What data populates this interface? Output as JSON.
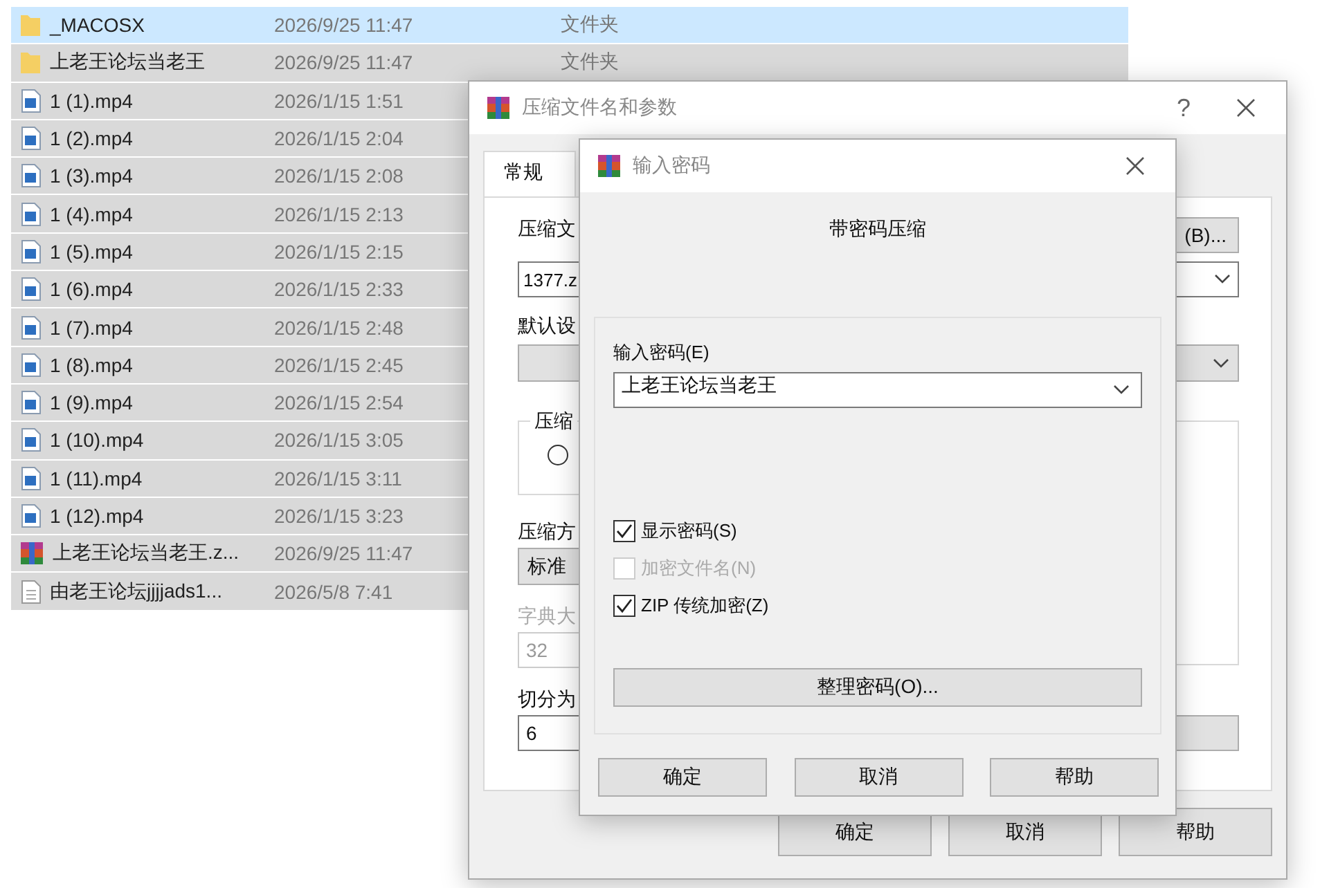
{
  "file_list": {
    "rows": [
      {
        "kind": "folder",
        "name": "_MACOSX",
        "date": "2026/9/25 11:47",
        "type": "文件夹",
        "selected": true,
        "focused": true
      },
      {
        "kind": "folder",
        "name": "上老王论坛当老王",
        "date": "2026/9/25 11:47",
        "type": "文件夹",
        "selected": true,
        "focused": false
      },
      {
        "kind": "video",
        "name": "1 (1).mp4",
        "date": "2026/1/15 1:51",
        "selected": true,
        "focused": false
      },
      {
        "kind": "video",
        "name": "1 (2).mp4",
        "date": "2026/1/15 2:04",
        "selected": true,
        "focused": false
      },
      {
        "kind": "video",
        "name": "1 (3).mp4",
        "date": "2026/1/15 2:08",
        "selected": true,
        "focused": false
      },
      {
        "kind": "video",
        "name": "1 (4).mp4",
        "date": "2026/1/15 2:13",
        "selected": true,
        "focused": false
      },
      {
        "kind": "video",
        "name": "1 (5).mp4",
        "date": "2026/1/15 2:15",
        "selected": true,
        "focused": false
      },
      {
        "kind": "video",
        "name": "1 (6).mp4",
        "date": "2026/1/15 2:33",
        "selected": true,
        "focused": false
      },
      {
        "kind": "video",
        "name": "1 (7).mp4",
        "date": "2026/1/15 2:48",
        "selected": true,
        "focused": false
      },
      {
        "kind": "video",
        "name": "1 (8).mp4",
        "date": "2026/1/15 2:45",
        "selected": true,
        "focused": false
      },
      {
        "kind": "video",
        "name": "1 (9).mp4",
        "date": "2026/1/15 2:54",
        "selected": true,
        "focused": false
      },
      {
        "kind": "video",
        "name": "1 (10).mp4",
        "date": "2026/1/15 3:05",
        "selected": true,
        "focused": false
      },
      {
        "kind": "video",
        "name": "1 (11).mp4",
        "date": "2026/1/15 3:11",
        "selected": true,
        "focused": false
      },
      {
        "kind": "video",
        "name": "1 (12).mp4",
        "date": "2026/1/15 3:23",
        "selected": true,
        "focused": false
      },
      {
        "kind": "archive",
        "name": "上老王论坛当老王.z...",
        "date": "2026/9/25 11:47",
        "selected": true,
        "focused": false
      },
      {
        "kind": "text",
        "name": "由老王论坛jjjjads1...",
        "date": "2026/5/8 7:41",
        "selected": true,
        "focused": false
      }
    ]
  },
  "archive_dialog": {
    "title": "压缩文件名和参数",
    "help": "?",
    "tabs": [
      {
        "label": "常规",
        "selected": true
      }
    ],
    "browse_button": "(B)...",
    "archive_name_label": "压缩文",
    "archive_name": "1377.z",
    "profile_label": "默认设",
    "group_label": "压缩",
    "radio": {
      "checked": false
    },
    "method_label": "压缩方",
    "method": "标准",
    "dictionary_label": "字典大",
    "dictionary": "32",
    "split_label": "切分为",
    "split": "6",
    "buttons": [
      "确定",
      "取消",
      "帮助"
    ]
  },
  "password_dialog": {
    "title": "输入密码",
    "heading": "带密码压缩",
    "password_label": "输入密码(E)",
    "password": "上老王论坛当老王",
    "options": [
      {
        "label": "显示密码(S)",
        "checked": true,
        "disabled": false
      },
      {
        "label": "加密文件名(N)",
        "checked": false,
        "disabled": true
      },
      {
        "label": "ZIP 传统加密(Z)",
        "checked": true,
        "disabled": false
      }
    ],
    "organize_button": "整理密码(O)...",
    "buttons": [
      "确定",
      "取消",
      "帮助"
    ]
  }
}
